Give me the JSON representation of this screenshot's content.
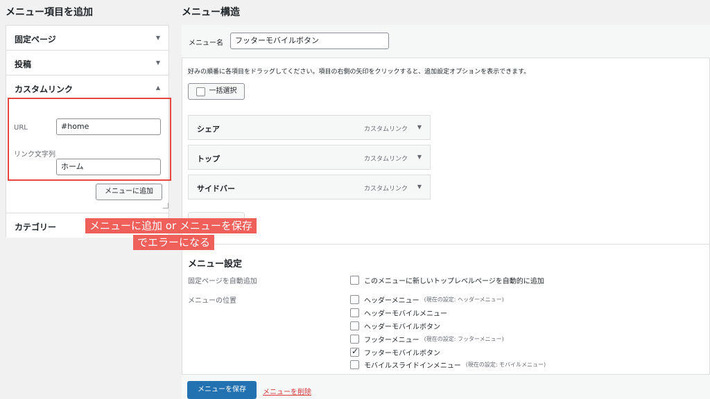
{
  "left": {
    "title": "メニュー項目を追加",
    "accordion": [
      {
        "label": "固定ページ"
      },
      {
        "label": "投稿"
      },
      {
        "label": "カスタムリンク"
      },
      {
        "label": "カテゴリー"
      }
    ],
    "custom_link": {
      "url_label": "URL",
      "url_value": "#home",
      "text_label": "リンク文字列",
      "text_value": "ホーム",
      "add_button": "メニューに追加"
    }
  },
  "annotation": {
    "line1": "メニューに追加 or メニューを保存",
    "line2": "でエラーになる"
  },
  "right": {
    "title": "メニュー構造",
    "menu_name_label": "メニュー名",
    "menu_name_value": "フッターモバイルボタン",
    "instructions": "好みの順番に各項目をドラッグしてください。項目の右側の矢印をクリックすると、追加設定オプションを表示できます。",
    "bulk_select": "一括選択",
    "items": [
      {
        "name": "シェア",
        "type": "カスタムリンク"
      },
      {
        "name": "トップ",
        "type": "カスタムリンク"
      },
      {
        "name": "サイドバー",
        "type": "カスタムリンク"
      }
    ],
    "settings": {
      "title": "メニュー設定",
      "auto_add_label": "固定ページを自動追加",
      "auto_add_option": "このメニューに新しいトップレベルページを自動的に追加",
      "location_label": "メニューの位置",
      "locations": [
        {
          "name": "ヘッダーメニュー",
          "current": "(現在の設定: ヘッダーメニュー)",
          "checked": false
        },
        {
          "name": "ヘッダーモバイルメニュー",
          "current": "",
          "checked": false
        },
        {
          "name": "ヘッダーモバイルボタン",
          "current": "",
          "checked": false
        },
        {
          "name": "フッターメニュー",
          "current": "(現在の設定: フッターメニュー)",
          "checked": false
        },
        {
          "name": "フッターモバイルボタン",
          "current": "",
          "checked": true
        },
        {
          "name": "モバイルスライドインメニュー",
          "current": "(現在の設定: モバイルメニュー)",
          "checked": false
        }
      ]
    },
    "save_button": "メニューを保存",
    "delete_link": "メニューを削除"
  },
  "colors": {
    "primary": "#2271b1",
    "annotation_red": "#e7453e",
    "delete_red": "#d63638"
  }
}
